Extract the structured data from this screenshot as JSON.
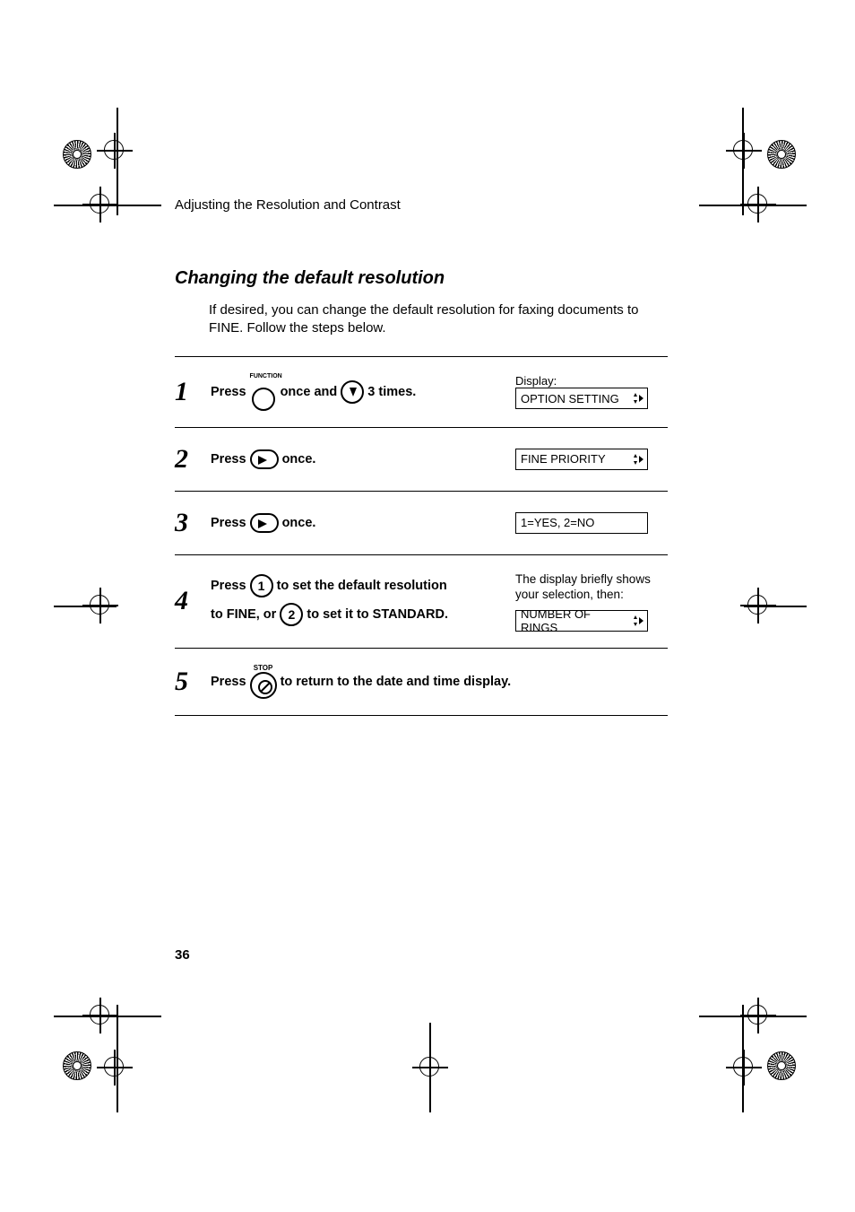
{
  "header": {
    "title": "Adjusting the Resolution and Contrast"
  },
  "section": {
    "heading": "Changing the default resolution",
    "intro": "If desired, you can change the default resolution for faxing documents to FINE. Follow the steps below."
  },
  "labels": {
    "display": "Display:",
    "function": "FUNCTION",
    "stop": "STOP"
  },
  "steps": [
    {
      "num": "1",
      "parts": {
        "p1": "Press",
        "p2": "once and",
        "p3": "3 times."
      },
      "display": "OPTION SETTING"
    },
    {
      "num": "2",
      "parts": {
        "p1": "Press",
        "p2": "once."
      },
      "display": "FINE PRIORITY"
    },
    {
      "num": "3",
      "parts": {
        "p1": "Press",
        "p2": "once."
      },
      "display": "1=YES, 2=NO"
    },
    {
      "num": "4",
      "parts": {
        "p1": "Press",
        "p2": "to set the default resolution",
        "p3": "to FINE, or",
        "p4": "to set it to STANDARD."
      },
      "note": "The display briefly shows your selection, then:",
      "display": "NUMBER OF RINGS"
    },
    {
      "num": "5",
      "parts": {
        "p1": "Press",
        "p2": "to return to the date and time display."
      }
    }
  ],
  "buttons": {
    "one": "1",
    "two": "2"
  },
  "page_number": "36"
}
